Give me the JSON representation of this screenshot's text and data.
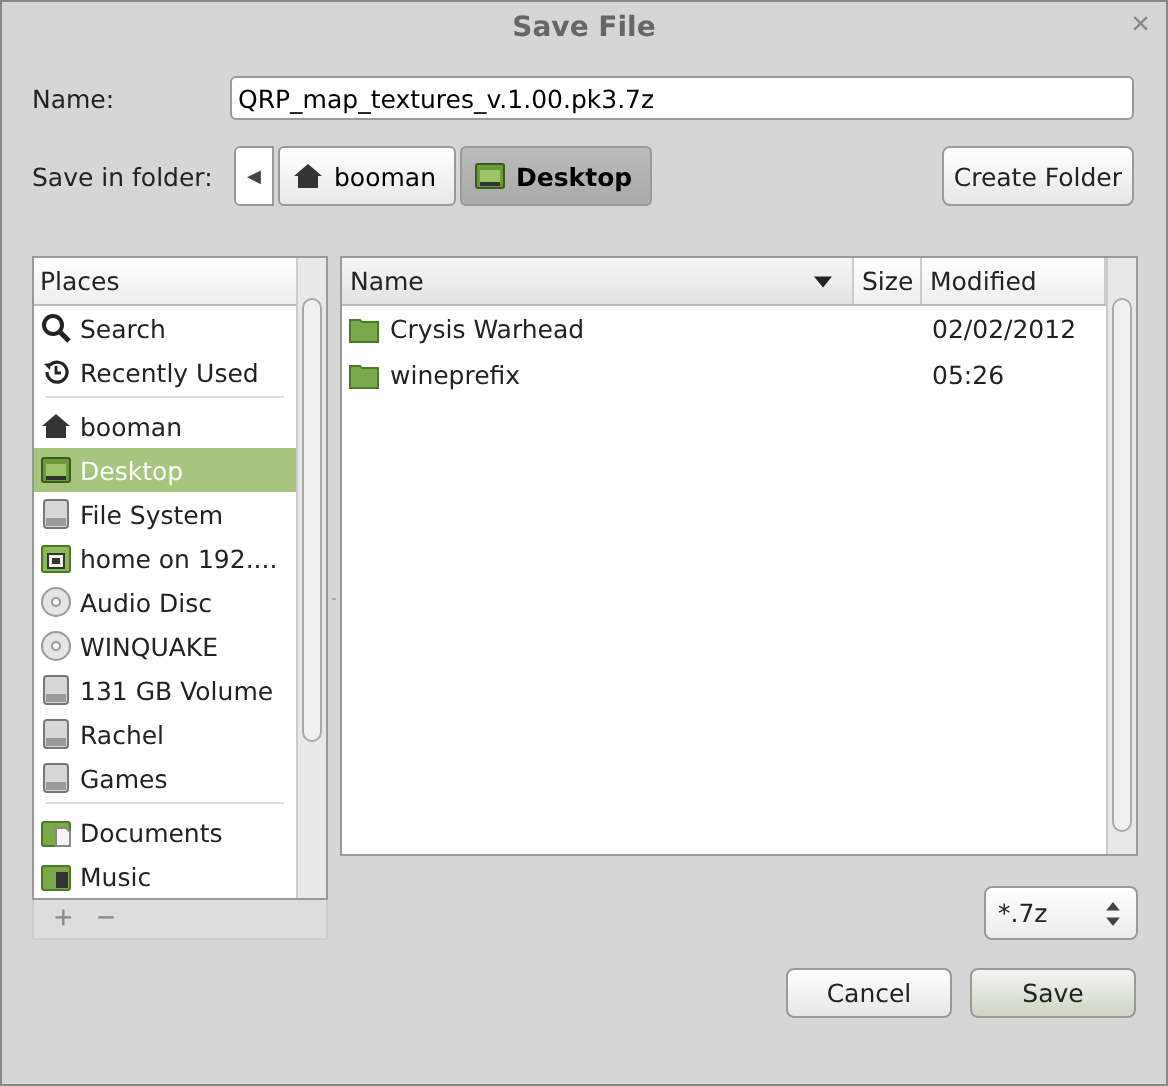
{
  "window": {
    "title": "Save File",
    "close": "×"
  },
  "name_field": {
    "label": "Name:",
    "value": "QRP_map_textures_v.1.00.pk3.7z"
  },
  "folder": {
    "label": "Save in folder:",
    "back": "◀",
    "path": [
      {
        "label": "booman",
        "kind": "home",
        "selected": false
      },
      {
        "label": "Desktop",
        "kind": "desktop",
        "selected": true
      }
    ],
    "create_button": "Create Folder"
  },
  "places": {
    "header": "Places",
    "sections": [
      [
        {
          "label": "Search",
          "kind": "search",
          "selected": false
        },
        {
          "label": "Recently Used",
          "kind": "recent",
          "selected": false
        }
      ],
      [
        {
          "label": "booman",
          "kind": "home",
          "selected": false
        },
        {
          "label": "Desktop",
          "kind": "desktop",
          "selected": true
        },
        {
          "label": "File System",
          "kind": "drive",
          "selected": false
        },
        {
          "label": "home on 192....",
          "kind": "network",
          "selected": false
        },
        {
          "label": "Audio Disc",
          "kind": "disc",
          "selected": false
        },
        {
          "label": "WINQUAKE",
          "kind": "disc",
          "selected": false
        },
        {
          "label": "131 GB Volume",
          "kind": "drive",
          "selected": false
        },
        {
          "label": "Rachel",
          "kind": "drive",
          "selected": false
        },
        {
          "label": "Games",
          "kind": "drive",
          "selected": false
        }
      ],
      [
        {
          "label": "Documents",
          "kind": "documents",
          "selected": false
        },
        {
          "label": "Music",
          "kind": "music",
          "selected": false
        }
      ]
    ],
    "add": {
      "label": "+",
      "disabled": true
    },
    "remove": {
      "label": "−",
      "disabled": true
    }
  },
  "files": {
    "columns": [
      {
        "label": "Name",
        "sorted": true
      },
      {
        "label": "Size",
        "sorted": false
      },
      {
        "label": "Modified",
        "sorted": false
      }
    ],
    "rows": [
      {
        "name": "Crysis Warhead",
        "modified": "02/02/2012",
        "kind": "folder"
      },
      {
        "name": "wineprefix",
        "modified": "05:26",
        "kind": "folder"
      }
    ]
  },
  "filter": {
    "value": "*.7z"
  },
  "buttons": [
    {
      "label": "Cancel",
      "kind": "cancel"
    },
    {
      "label": "Save",
      "kind": "default"
    }
  ]
}
